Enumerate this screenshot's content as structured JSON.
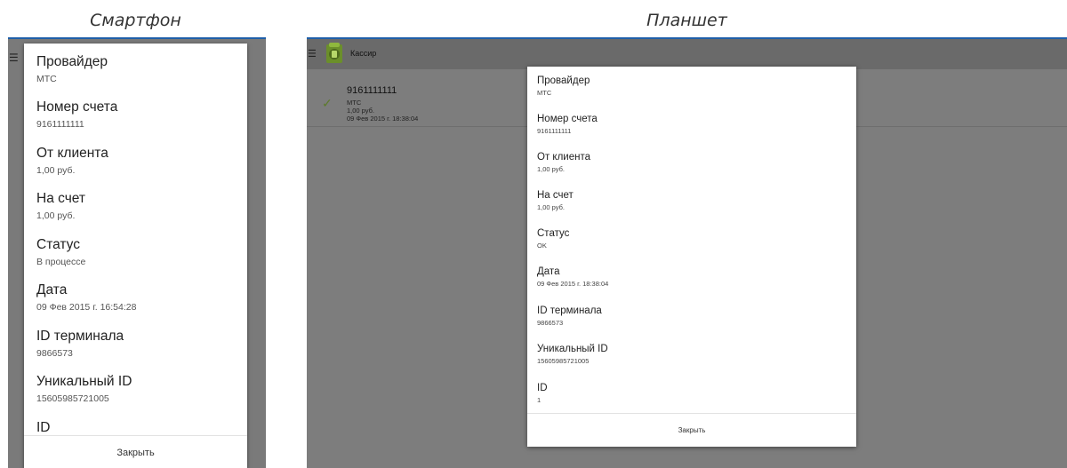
{
  "captions": {
    "phone": "Смартфон",
    "tablet": "Планшет"
  },
  "icons": {
    "menu": "hamburger-menu-icon",
    "app_logo": "android-app-icon",
    "status": "checkmark-icon"
  },
  "colors": {
    "accent": "#1f5fa8",
    "overlay": "#7a7a7a",
    "check": "#5d7a2c"
  },
  "phone": {
    "dialog": {
      "fields": [
        {
          "label": "Провайдер",
          "value": "МТС"
        },
        {
          "label": "Номер счета",
          "value": "9161111111"
        },
        {
          "label": "От клиента",
          "value": "1,00 руб."
        },
        {
          "label": "На счет",
          "value": "1,00 руб."
        },
        {
          "label": "Статус",
          "value": "В процессе"
        },
        {
          "label": "Дата",
          "value": "09 Фев 2015 г. 16:54:28"
        },
        {
          "label": "ID терминала",
          "value": "9866573"
        },
        {
          "label": "Уникальный ID",
          "value": "15605985721005"
        },
        {
          "label": "ID",
          "value": ""
        }
      ],
      "close_label": "Закрыть"
    }
  },
  "tablet": {
    "app_title": "Кассир",
    "list": [
      {
        "title": "9161111111",
        "provider": "МТС",
        "amount": "1,00 руб.",
        "date": "09 Фев 2015 г. 18:38:04"
      }
    ],
    "dialog": {
      "fields": [
        {
          "label": "Провайдер",
          "value": "МТС"
        },
        {
          "label": "Номер счета",
          "value": "9161111111"
        },
        {
          "label": "От клиента",
          "value": "1,00 руб."
        },
        {
          "label": "На счет",
          "value": "1,00 руб."
        },
        {
          "label": "Статус",
          "value": "OK"
        },
        {
          "label": "Дата",
          "value": "09 Фев 2015 г. 18:38:04"
        },
        {
          "label": "ID терминала",
          "value": "9866573"
        },
        {
          "label": "Уникальный ID",
          "value": "15605985721005"
        },
        {
          "label": "ID",
          "value": "1"
        }
      ],
      "close_label": "Закрыть"
    }
  }
}
